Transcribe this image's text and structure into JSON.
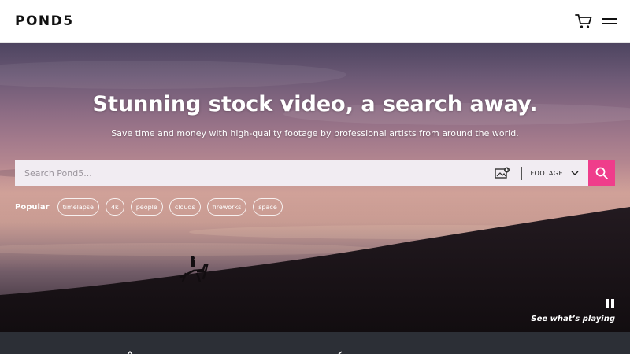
{
  "header": {
    "logo_text": "POND5",
    "cart_icon": "cart-icon",
    "menu_icon": "hamburger-menu-icon"
  },
  "hero": {
    "headline": "Stunning stock video, a search away.",
    "subheadline": "Save time and money with high-quality footage by professional artists from around the world.",
    "background": "sunset-silhouette-horse-rider"
  },
  "search": {
    "placeholder": "Search Pond5...",
    "value": "",
    "media_type": "FOOTAGE",
    "image_search_icon": "image-search-icon",
    "search_icon": "search-icon",
    "accent_color": "#ef3d8b"
  },
  "popular": {
    "label": "Popular",
    "tags": [
      "timelapse",
      "4k",
      "people",
      "clouds",
      "fireworks",
      "space"
    ]
  },
  "player": {
    "pause_icon": "pause-icon",
    "see_playing": "See what’s playing"
  }
}
